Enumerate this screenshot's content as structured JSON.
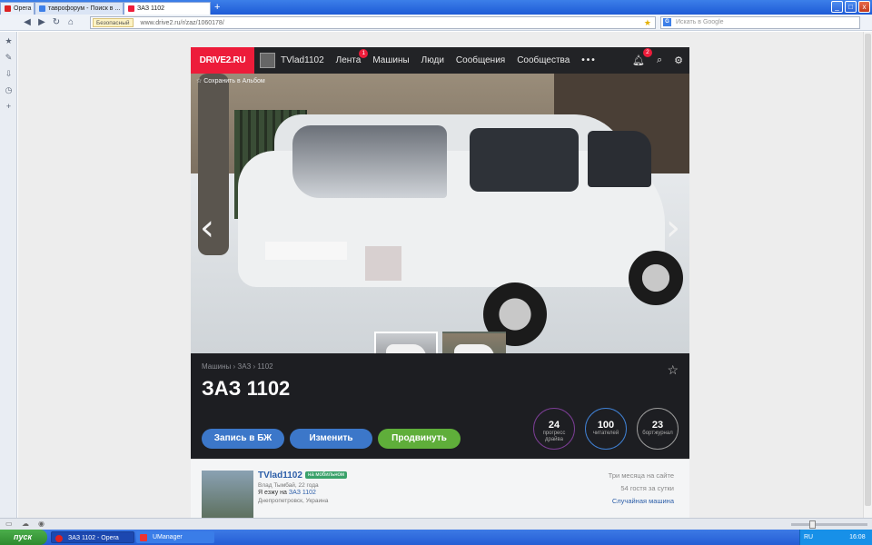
{
  "browser": {
    "opera_tab": "Opera",
    "tabs": [
      {
        "label": "таврофорум - Поиск в ..."
      },
      {
        "label": "ЗАЗ 1102"
      }
    ],
    "new_tab": "+",
    "secure_label": "Безопасный",
    "url": "www.drive2.ru/r/zaz/1060178/",
    "search_placeholder": "Искать в Google",
    "window_buttons": {
      "minimize": "_",
      "maximize": "□",
      "close": "x"
    }
  },
  "site": {
    "logo": "DRIVE2.RU",
    "nav": {
      "user": "TVlad1102",
      "feed": "Лента",
      "feed_badge": "1",
      "cars": "Машины",
      "people": "Люди",
      "messages": "Сообщения",
      "communities": "Сообщества",
      "more": "•••",
      "bell_badge": "2"
    },
    "photo": {
      "save_album": "Сохранить в Альбом",
      "prev": "‹",
      "next": "›"
    },
    "breadcrumb": "Машины › ЗАЗ › 1102",
    "title": "ЗАЗ 1102",
    "buttons": {
      "journal": "Запись в БЖ",
      "edit": "Изменить",
      "promote": "Продвинуть"
    },
    "stats": [
      {
        "value": "24",
        "label": "прогресс драйва"
      },
      {
        "value": "100",
        "label": "читателей"
      },
      {
        "value": "23",
        "label": "бортжурнал"
      }
    ],
    "owner": {
      "name": "TVlad1102",
      "tag": "на мобильном",
      "subtitle": "Влад Тымбай, 22 года",
      "drives_prefix": "Я езжу на",
      "drives_car": "ЗАЗ 1102",
      "location": "Днепропетровск, Украина",
      "stat1": "Три месяца на сайте",
      "stat2": "54 гостя за сутки",
      "random": "Случайная машина"
    }
  },
  "taskbar": {
    "start": "пуск",
    "items": [
      {
        "label": "ЗАЗ 1102 - Opera"
      },
      {
        "label": "UManager"
      }
    ],
    "lang": "RU",
    "time": "16:08"
  }
}
